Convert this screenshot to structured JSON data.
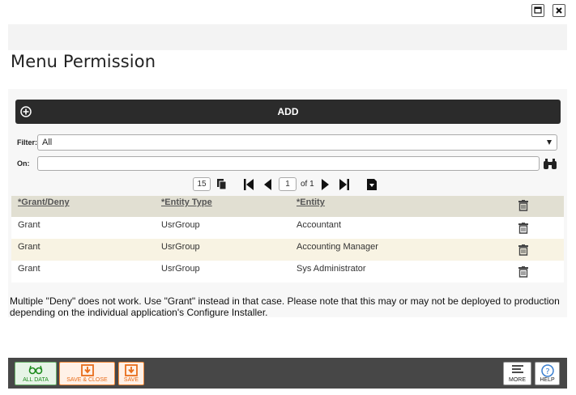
{
  "window": {
    "maximize_icon": "maximize-icon",
    "close_icon": "close-icon"
  },
  "page": {
    "title": "Menu Permission"
  },
  "add_bar": {
    "label": "ADD",
    "icon": "plus-circle-icon"
  },
  "filter": {
    "label": "Filter:",
    "value": "All"
  },
  "on": {
    "label": "On:",
    "value": ""
  },
  "pager": {
    "page_size": "15",
    "current_page": "1",
    "of_label": "of 1"
  },
  "grid": {
    "columns": [
      "*Grant/Deny",
      "*Entity Type",
      "*Entity"
    ],
    "rows": [
      [
        "Grant",
        "UsrGroup",
        "Accountant"
      ],
      [
        "Grant",
        "UsrGroup",
        "Accounting Manager"
      ],
      [
        "Grant",
        "UsrGroup",
        "Sys Administrator"
      ]
    ]
  },
  "note": "Multiple \"Deny\" does not work. Use \"Grant\" instead in that case. Please note that this may or may not be deployed to production depending on the individual application's Configure Installer.",
  "footer": {
    "all_data": "ALL DATA",
    "save_close": "SAVE & CLOSE",
    "save": "SAVE",
    "more": "MORE",
    "help": "HELP"
  },
  "colors": {
    "header_row": "#e1dfd2",
    "alt_row": "#f8f3e3",
    "footer_bg": "#474747",
    "save_accent": "#e86d1b",
    "alldata_accent": "#1c8a1c"
  }
}
